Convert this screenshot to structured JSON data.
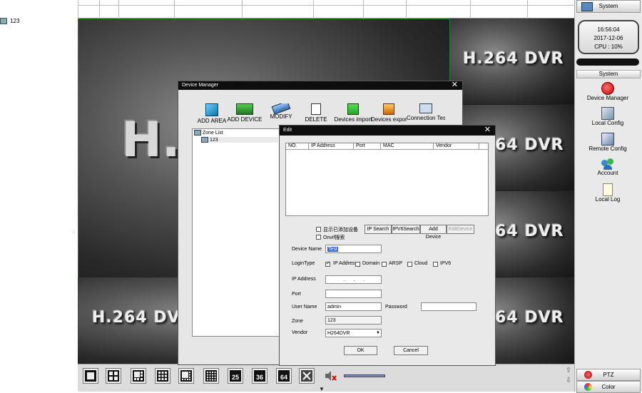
{
  "desktop": {
    "icon_label": "123"
  },
  "video": {
    "logo_text": "H.264 DVR",
    "big_fragment": "H."
  },
  "right_panel": {
    "top_button": "System",
    "clock": {
      "time": "16:56:04",
      "date": "2017-12-06",
      "cpu": "CPU : 10%"
    },
    "section_header": "System",
    "items": [
      {
        "label": "Device Manager",
        "icon": "record-dot-icon"
      },
      {
        "label": "Local Config",
        "icon": "local-config-icon"
      },
      {
        "label": "Remote Config",
        "icon": "remote-config-icon"
      },
      {
        "label": "Account",
        "icon": "users-icon"
      },
      {
        "label": "Local Log",
        "icon": "log-document-icon"
      }
    ],
    "bottom_items": [
      {
        "label": "PTZ",
        "icon": "ptz-icon"
      },
      {
        "label": "Color",
        "icon": "color-icon"
      }
    ]
  },
  "bottom_bar": {
    "layouts": [
      "1",
      "4",
      "6",
      "9",
      "8",
      "16",
      "25",
      "36",
      "64"
    ]
  },
  "device_manager": {
    "title": "Device Manager",
    "toolbar": [
      "ADD AREA",
      "ADD DEVICE",
      "MODIFY",
      "DELETE",
      "Devices import",
      "Devices export",
      "Connection Test"
    ],
    "tree": {
      "root": "Zone List",
      "child": "123"
    }
  },
  "edit_dialog": {
    "title": "Edit",
    "table_headers": [
      "NO.",
      "IP Address",
      "Port",
      "MAC",
      "Vendor"
    ],
    "show_added_label": "显示已添加设备",
    "onvif_label": "Onvif搜索",
    "search_buttons": [
      "IP Search",
      "IPV6Search",
      "Add Device",
      "EditDevice"
    ],
    "device_name_label": "Device Name",
    "device_name_value": "Test",
    "login_type_label": "LoginType",
    "login_types": [
      {
        "label": "IP Address",
        "checked": true
      },
      {
        "label": "Domain",
        "checked": false
      },
      {
        "label": "ARSP",
        "checked": false
      },
      {
        "label": "Cloud",
        "checked": false
      },
      {
        "label": "IPV6",
        "checked": false
      }
    ],
    "ip_address_label": "IP Address",
    "ip_address_value": ".      .      .",
    "port_label": "Port",
    "port_value": "",
    "username_label": "User Name",
    "username_value": "admin",
    "password_label": "Password",
    "password_value": "",
    "zone_label": "Zone",
    "zone_value": "123",
    "vendor_label": "Vendor",
    "vendor_value": "H264DVR",
    "ok": "OK",
    "cancel": "Cancel"
  }
}
